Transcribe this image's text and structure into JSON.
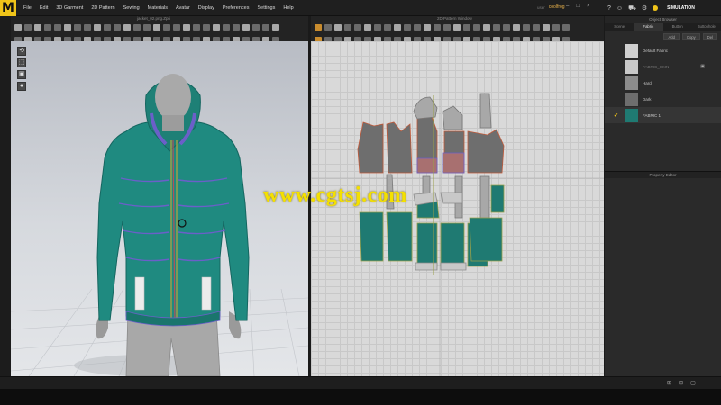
{
  "app": {
    "logo": "M"
  },
  "menu": [
    "File",
    "Edit",
    "3D Garment",
    "2D Pattern",
    "Sewing",
    "Materials",
    "Avatar",
    "Display",
    "Preferences",
    "Settings",
    "Help"
  ],
  "user": {
    "label": "user",
    "name": "coolfrog"
  },
  "window_controls": [
    "–",
    "□",
    "×"
  ],
  "simulation": {
    "label": "SIMULATION",
    "icons": [
      "help-icon",
      "user-icon",
      "cart-icon",
      "settings-icon"
    ]
  },
  "view3d": {
    "title": "jacket_02.png.Zpri"
  },
  "view2d": {
    "title": "2D Pattern Window"
  },
  "object_browser": {
    "title": "Object Browser",
    "tabs": [
      "Scene",
      "Fabric",
      "Button",
      "Buttonhole"
    ],
    "active_tab": "Fabric",
    "buttons": [
      "Add",
      "Copy",
      "Del"
    ],
    "fabrics": [
      {
        "name": "Default Fabric",
        "color": "#d0d0d0",
        "selected": false
      },
      {
        "name": "FABRIC_SKIN",
        "color": "#c8c8c8",
        "selected": false
      },
      {
        "name": "Hard",
        "color": "#8c8c8c",
        "selected": false
      },
      {
        "name": "Dark",
        "color": "#6e6e6e",
        "selected": false
      },
      {
        "name": "FABRIC 1",
        "color": "#1f7a72",
        "selected": true
      }
    ]
  },
  "property_editor": {
    "title": "Property Editor"
  },
  "watermark": "www.cgtsj.com",
  "colors": {
    "accent": "#f0c419",
    "jacket": "#1f8a80",
    "seam": "#9aa04a",
    "piping": "#6b5fc9"
  }
}
